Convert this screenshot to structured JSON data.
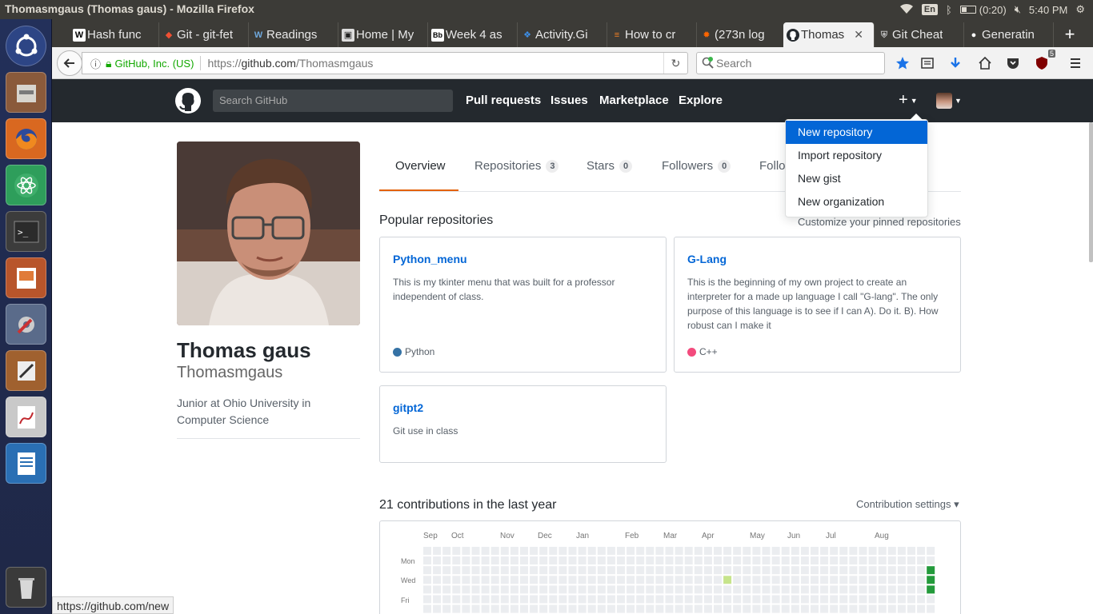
{
  "window": {
    "title": "Thomasmgaus (Thomas gaus) - Mozilla Firefox"
  },
  "tray": {
    "lang": "En",
    "battery": "(0:20)",
    "time": "5:40 PM"
  },
  "tabs": [
    {
      "label": "Hash func",
      "favicon": "W",
      "favicon_bg": "#ffffff",
      "favicon_fg": "#000000"
    },
    {
      "label": "Git - git-fet",
      "favicon": "◆",
      "favicon_bg": "#3c3b37",
      "favicon_fg": "#f05033"
    },
    {
      "label": "Readings",
      "favicon": "W",
      "favicon_bg": "#3c3b37",
      "favicon_fg": "#6fa8dc"
    },
    {
      "label": "Home | My",
      "favicon": "▣",
      "favicon_bg": "#dddddd",
      "favicon_fg": "#222222"
    },
    {
      "label": "Week 4 as",
      "favicon": "Bb",
      "favicon_bg": "#ffffff",
      "favicon_fg": "#000000"
    },
    {
      "label": "Activity.Gi",
      "favicon": "❖",
      "favicon_bg": "#3c3b37",
      "favicon_fg": "#3d8fe8"
    },
    {
      "label": "How to cr",
      "favicon": "≡",
      "favicon_bg": "#3c3b37",
      "favicon_fg": "#f48024"
    },
    {
      "label": "(273n log",
      "favicon": "✹",
      "favicon_bg": "#3c3b37",
      "favicon_fg": "#ff6600"
    },
    {
      "label": "Thomas",
      "favicon": "●",
      "favicon_bg": "#f2f2f2",
      "favicon_fg": "#24292e",
      "active": true
    },
    {
      "label": "Git Cheat",
      "favicon": "⛨",
      "favicon_bg": "#3c3b37",
      "favicon_fg": "#bbbbbb"
    },
    {
      "label": "Generatin",
      "favicon": "●",
      "favicon_bg": "#3c3b37",
      "favicon_fg": "#ffffff"
    }
  ],
  "navbar": {
    "identity": "GitHub, Inc. (US)",
    "url_scheme": "https://",
    "url_host": "github.com",
    "url_path": "/Thomasmgaus",
    "search_placeholder": "Search",
    "ublock_count": "5"
  },
  "github": {
    "search_placeholder": "Search GitHub",
    "nav": [
      "Pull requests",
      "Issues",
      "Marketplace",
      "Explore"
    ],
    "plus": "+"
  },
  "profile": {
    "fullname": "Thomas gaus",
    "username": "Thomasmgaus",
    "bio": "Junior at Ohio University in Computer Science"
  },
  "profile_tabs": [
    {
      "label": "Overview",
      "active": true
    },
    {
      "label": "Repositories",
      "count": "3"
    },
    {
      "label": "Stars",
      "count": "0"
    },
    {
      "label": "Followers",
      "count": "0"
    },
    {
      "label": "Follo"
    }
  ],
  "popular": {
    "title": "Popular repositories",
    "customize": "Customize your pinned repositories",
    "repos": [
      {
        "name": "Python_menu",
        "desc": "This is my tkinter menu that was built for a professor independent of class.",
        "lang": "Python",
        "lang_color": "#3572A5"
      },
      {
        "name": "G-Lang",
        "desc": "This is the beginning of my own project to create an interpreter for a made up language I call \"G-lang\". The only purpose of this language is to see if I can A). Do it. B). How robust can I make it",
        "lang": "C++",
        "lang_color": "#f34b7d"
      },
      {
        "name": "gitpt2",
        "desc": "Git use in class",
        "lang": ""
      }
    ]
  },
  "contributions": {
    "title": "21 contributions in the last year",
    "settings": "Contribution settings ▾",
    "months": [
      "Sep",
      "Oct",
      "Nov",
      "Dec",
      "Jan",
      "Feb",
      "Mar",
      "Apr",
      "May",
      "Jun",
      "Jul",
      "Aug"
    ],
    "days": [
      "Mon",
      "Wed",
      "Fri"
    ]
  },
  "dropdown": {
    "items": [
      "New repository",
      "Import repository",
      "New gist",
      "New organization"
    ]
  },
  "status": {
    "url": "https://github.com/new"
  },
  "colors": {
    "accent": "#0366d6",
    "tab_underline": "#e36209",
    "header": "#24292e"
  }
}
